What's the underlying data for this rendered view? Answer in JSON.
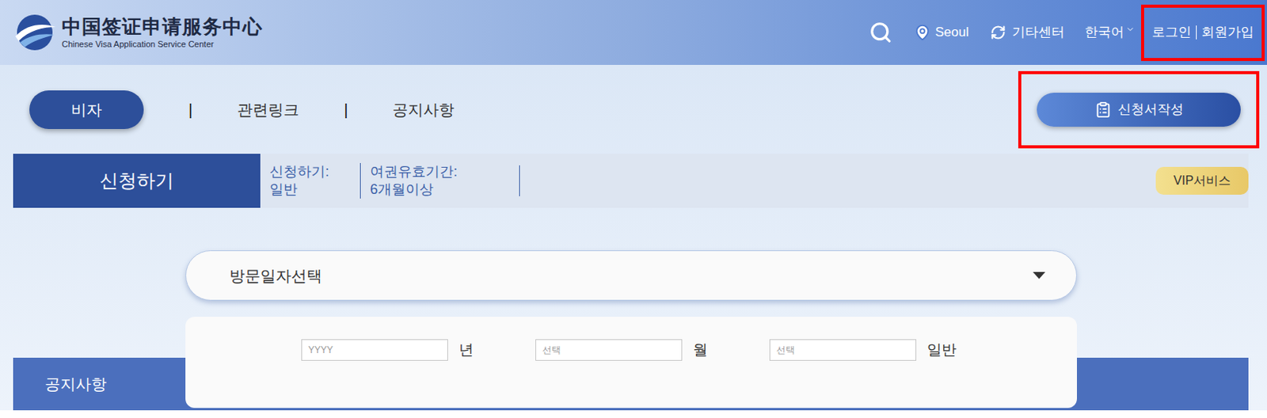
{
  "logo": {
    "title_cn": "中国签证申请服务中心",
    "title_en": "Chinese Visa Application Service Center"
  },
  "header": {
    "location": "Seoul",
    "center": "기타센터",
    "language": "한국어",
    "auth": {
      "login": "로그인",
      "signup": "회원가입",
      "highlighted": true
    }
  },
  "nav": {
    "tabs": [
      {
        "label": "비자",
        "selected": true
      },
      {
        "label": "관련링크",
        "selected": false
      },
      {
        "label": "공지사항",
        "selected": false
      }
    ],
    "separator": "|",
    "apply_button": {
      "label": "신청서작성",
      "highlighted": true
    }
  },
  "banner": {
    "title": "신청하기",
    "fields": [
      {
        "label": "신청하기:",
        "value": "일반"
      },
      {
        "label": "여권유효기간:",
        "value": "6개월이상"
      }
    ],
    "vip": "VIP서비스"
  },
  "date_picker": {
    "label": "방문일자선택",
    "expanded": true,
    "fields": [
      {
        "placeholder": "YYYY",
        "unit": "년"
      },
      {
        "placeholder": "선택",
        "unit": "월"
      },
      {
        "placeholder": "선택",
        "unit": "일반"
      }
    ]
  },
  "notice_bar": {
    "title": "공지사항"
  }
}
